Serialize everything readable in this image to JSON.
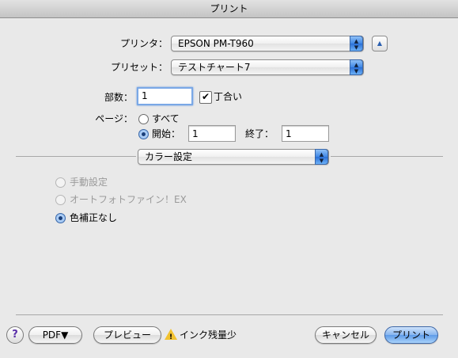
{
  "window": {
    "title": "プリント"
  },
  "printer": {
    "label": "プリンタ：",
    "value": "EPSON PM-T960"
  },
  "preset": {
    "label": "プリセット：",
    "value": "テストチャート7"
  },
  "copies": {
    "label": "部数：",
    "value": "1",
    "collate_label": "丁合い",
    "collate_checked": true
  },
  "pages": {
    "label": "ページ：",
    "all_label": "すべて",
    "from_label": "開始：",
    "from_value": "1",
    "to_label": "終了：",
    "to_value": "1",
    "selected": "range"
  },
  "panel": {
    "value": "カラー設定"
  },
  "color_options": [
    {
      "label": "手動設定",
      "enabled": false,
      "selected": false
    },
    {
      "label": "オートフォトファイン！EX",
      "enabled": false,
      "selected": false
    },
    {
      "label": "色補正なし",
      "enabled": true,
      "selected": true
    }
  ],
  "footer": {
    "help_label": "?",
    "pdf_label": "PDF▼",
    "preview_label": "プレビュー",
    "warning_text": "インク残量少",
    "cancel_label": "キャンセル",
    "print_label": "プリント"
  },
  "colors": {
    "accent": "#5d9ae8",
    "warning": "#f2c230",
    "background": "#e9e9e9"
  }
}
